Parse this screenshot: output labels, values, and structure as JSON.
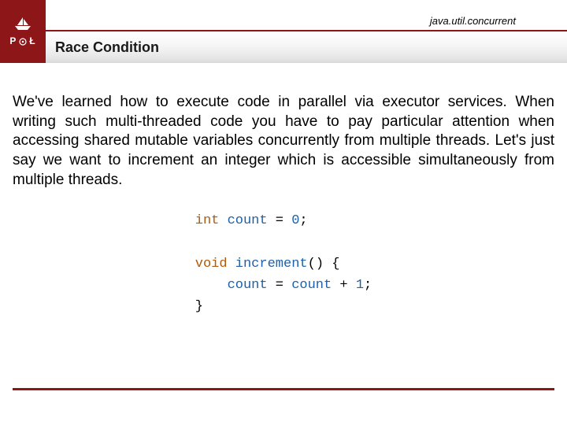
{
  "header": {
    "package_label": "java.util.concurrent",
    "logo_letters_left": "P",
    "logo_letters_right": "Ł"
  },
  "title": "Race Condition",
  "body": "We've learned how to execute code in parallel via executor services. When writing such multi-threaded code you have to pay particular attention when accessing shared mutable variables concurrently from multiple threads. Let's just say we want to increment an integer which is accessible simultaneously from multiple threads.",
  "code": {
    "kw_int": "int",
    "ident_count1": "count",
    "eq1": "=",
    "val0": "0",
    "semi1": ";",
    "kw_void": "void",
    "ident_increment": "increment",
    "paren_open": "(",
    "paren_close": ")",
    "brace_open": "{",
    "ident_count2": "count",
    "eq2": "=",
    "ident_count3": "count",
    "plus": "+",
    "val1": "1",
    "semi2": ";",
    "brace_close": "}"
  },
  "colors": {
    "brand": "#8c1618",
    "keyword": "#b05a0a",
    "identifier": "#2060a8",
    "plain": "#6f6f6f"
  }
}
